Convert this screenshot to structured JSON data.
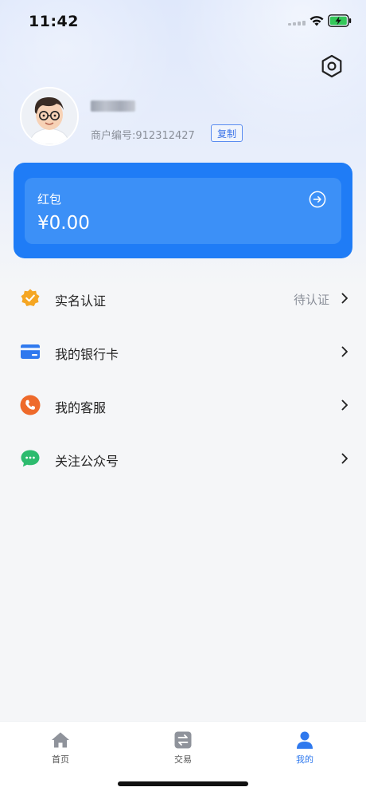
{
  "status_bar": {
    "time": "11:42"
  },
  "profile": {
    "merchant_id_text": "商户编号:912312427",
    "copy_label": "复制"
  },
  "wallet_card": {
    "title": "红包",
    "amount": "¥0.00"
  },
  "menu": {
    "items": [
      {
        "label": "实名认证",
        "value": "待认证",
        "icon": "verified-badge-icon",
        "color": "#f5a623"
      },
      {
        "label": "我的银行卡",
        "value": "",
        "icon": "bank-card-icon",
        "color": "#2f79ee"
      },
      {
        "label": "我的客服",
        "value": "",
        "icon": "phone-icon",
        "color": "#ee6a2b"
      },
      {
        "label": "关注公众号",
        "value": "",
        "icon": "chat-bubble-icon",
        "color": "#2dbb6e"
      }
    ]
  },
  "tabbar": {
    "tabs": [
      {
        "label": "首页",
        "icon": "home-icon",
        "active": false
      },
      {
        "label": "交易",
        "icon": "transfer-icon",
        "active": false
      },
      {
        "label": "我的",
        "icon": "user-icon",
        "active": true
      }
    ]
  },
  "colors": {
    "accent": "#2f79ee",
    "card": "#1f7cf6",
    "card_inner": "#3c90f7"
  }
}
